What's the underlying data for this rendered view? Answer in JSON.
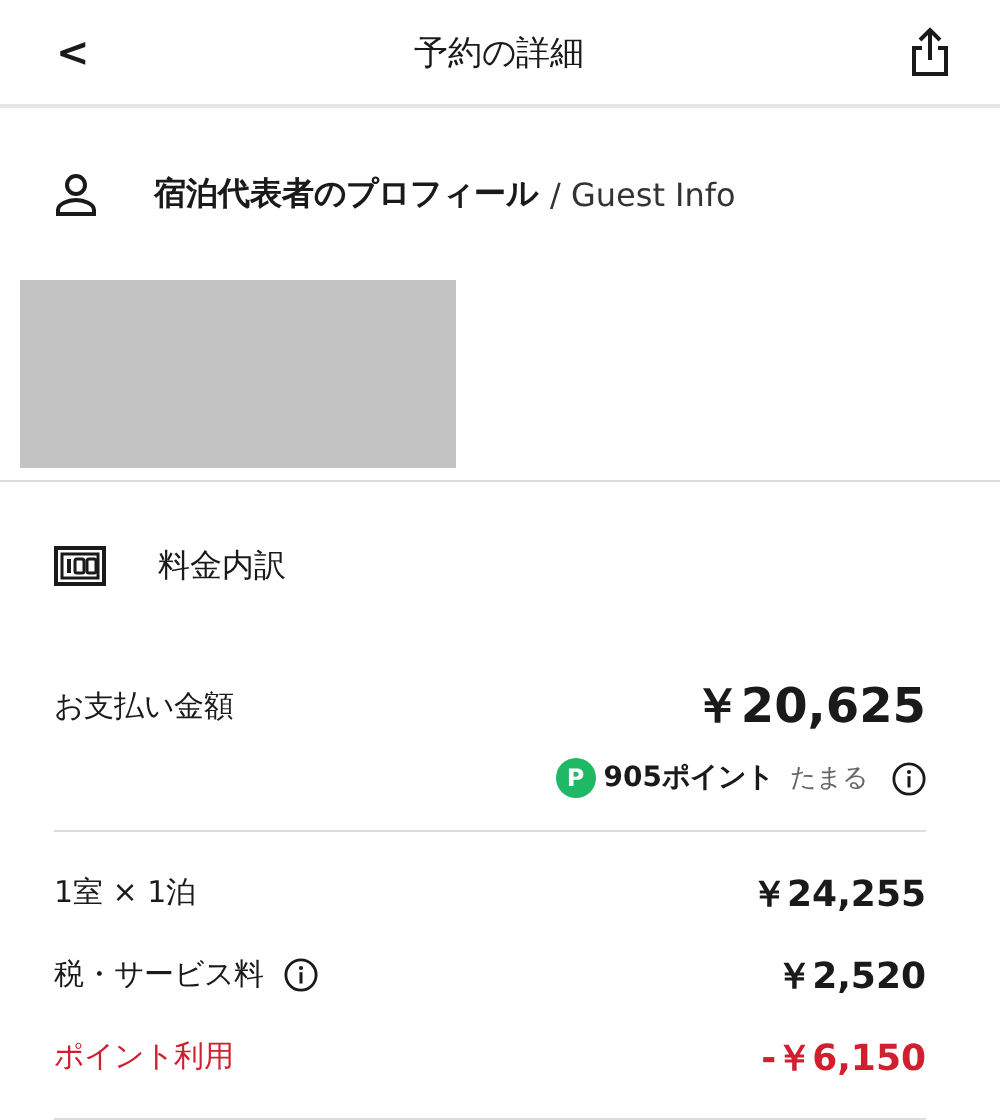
{
  "header": {
    "back": "<",
    "title": "予約の詳細"
  },
  "guest": {
    "title": "宿泊代表者のプロフィール",
    "subtitle": "/ Guest Info",
    "redacted": true
  },
  "fees": {
    "title": "料金内訳",
    "total": {
      "label": "お支払い金額",
      "amount": "￥20,625"
    },
    "points": {
      "badge": "P",
      "amount": "905ポイント",
      "note": "たまる"
    },
    "items": [
      {
        "label": "1室 × 1泊",
        "amount": "￥24,255",
        "kind": "normal",
        "info": false
      },
      {
        "label": "税・サービス料",
        "amount": "￥2,520",
        "kind": "normal",
        "info": true
      },
      {
        "label": "ポイント利用",
        "amount": "-￥6,150",
        "kind": "discount",
        "info": false
      }
    ]
  }
}
